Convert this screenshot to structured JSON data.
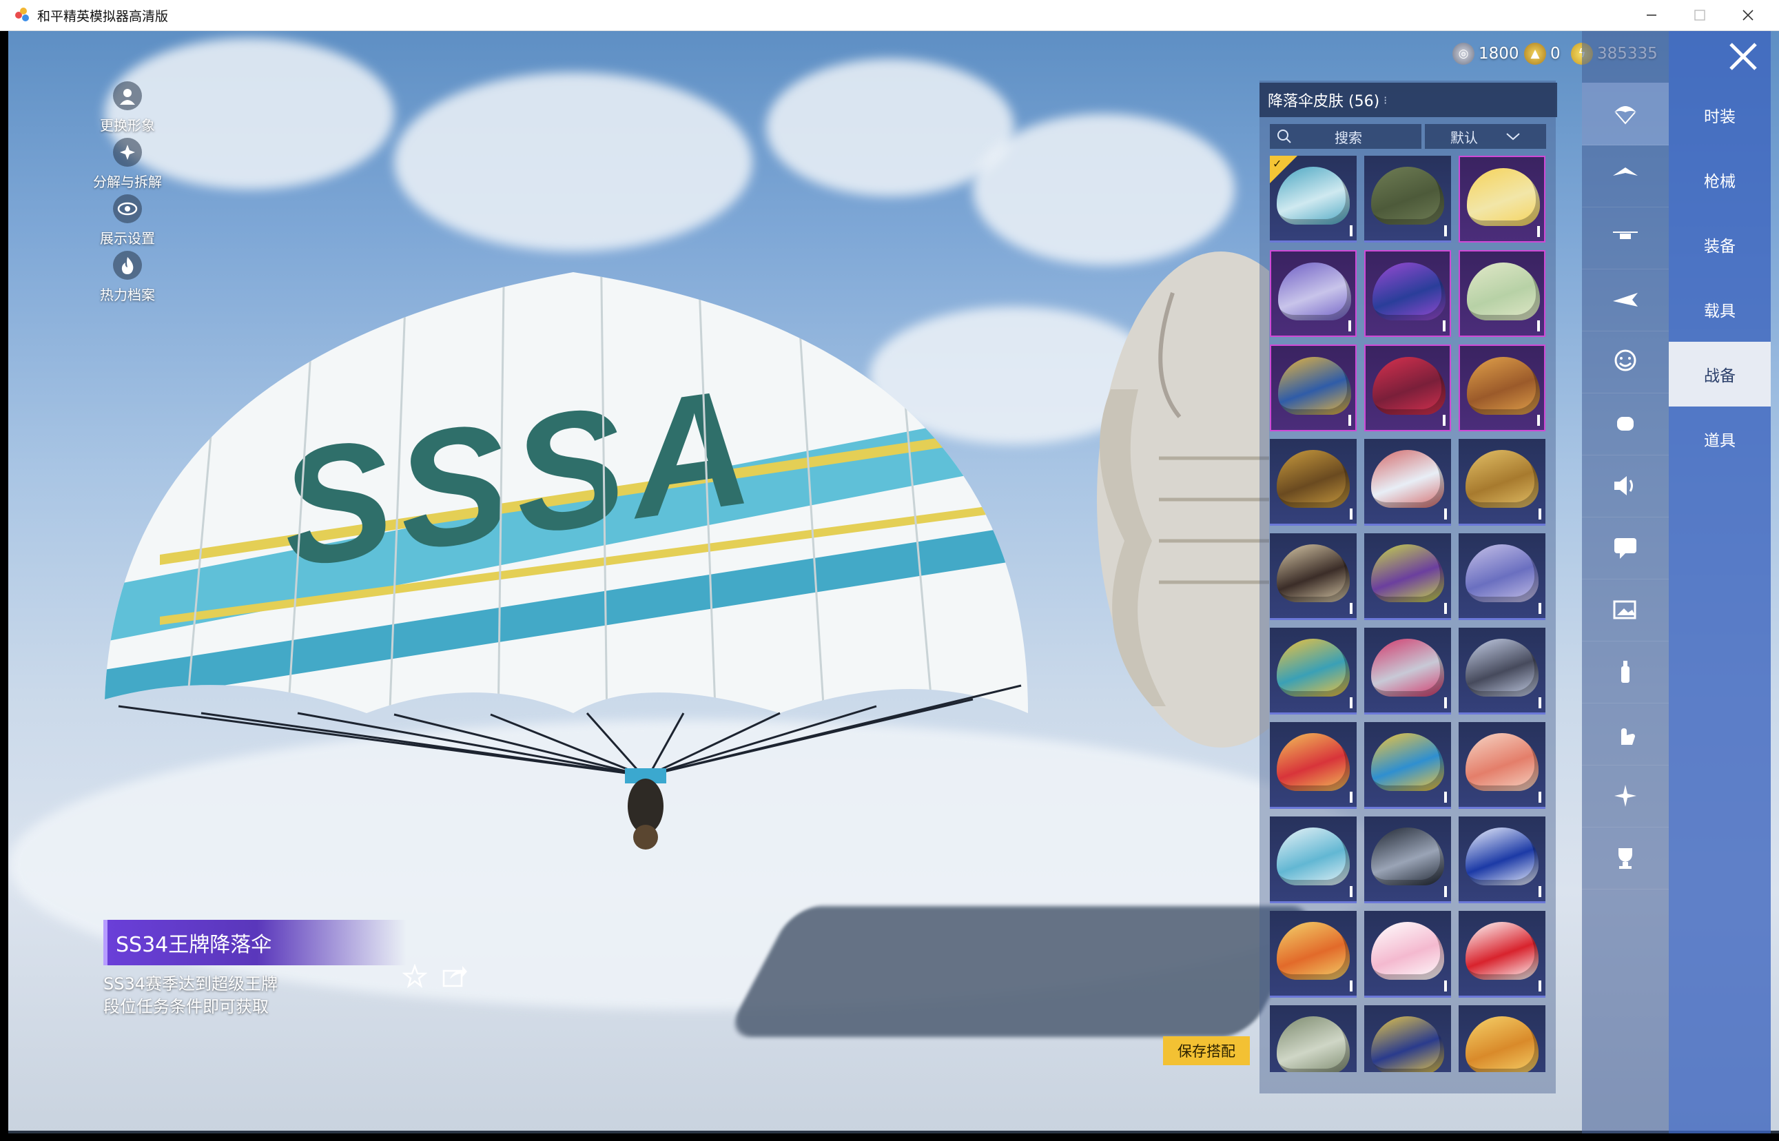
{
  "window": {
    "title": "和平精英模拟器高清版"
  },
  "left_tools": [
    {
      "label": "更换形象",
      "icon": "avatar-icon"
    },
    {
      "label": "分解与拆解",
      "icon": "dismantle-icon"
    },
    {
      "label": "展示设置",
      "icon": "eye-icon"
    },
    {
      "label": "热力档案",
      "icon": "flame-icon"
    }
  ],
  "currencies": [
    {
      "icon": "coin-silver-icon",
      "amount": "1800"
    },
    {
      "icon": "coin-gold-icon",
      "amount": "0"
    },
    {
      "icon": "coin-lightning-icon",
      "amount": "385335"
    }
  ],
  "panel": {
    "header": "降落伞皮肤 (56)",
    "search_placeholder": "搜索",
    "sort_label": "默认"
  },
  "item": {
    "name": "SS34王牌降落伞",
    "description_line1": "SS34赛季达到超级王牌",
    "description_line2": "段位任务条件即可获取",
    "save_label": "保存搭配"
  },
  "skins": [
    {
      "frame": "blue",
      "color": "#cfe9f0",
      "accent": "#4aa6c2",
      "selected": true
    },
    {
      "frame": "blue",
      "color": "#4d5a3a",
      "accent": "#6f7d55",
      "selected": false
    },
    {
      "frame": "purple",
      "color": "#f2e6a8",
      "accent": "#f6d35a",
      "selected": false
    },
    {
      "frame": "purple",
      "color": "#c8c4ea",
      "accent": "#6f5fc5",
      "selected": false
    },
    {
      "frame": "purple",
      "color": "#2a3e9a",
      "accent": "#9a4ad3",
      "selected": false
    },
    {
      "frame": "purple",
      "color": "#b7d1a6",
      "accent": "#e1e8c8",
      "selected": false
    },
    {
      "frame": "purple",
      "color": "#2f5ca8",
      "accent": "#e8b53d",
      "selected": false
    },
    {
      "frame": "purple",
      "color": "#7a1f3a",
      "accent": "#d8314f",
      "selected": false
    },
    {
      "frame": "purple",
      "color": "#9b5a2a",
      "accent": "#e2a24b",
      "selected": false
    },
    {
      "frame": "blue",
      "color": "#6a4a20",
      "accent": "#c99b3e",
      "selected": false
    },
    {
      "frame": "blue",
      "color": "#e8eef6",
      "accent": "#d46a6a",
      "selected": false
    },
    {
      "frame": "blue",
      "color": "#a77a2e",
      "accent": "#e3c067",
      "selected": false
    },
    {
      "frame": "blue",
      "color": "#3b2d28",
      "accent": "#d8c9a8",
      "selected": false
    },
    {
      "frame": "blue",
      "color": "#6b3f9e",
      "accent": "#c8d64a",
      "selected": false
    },
    {
      "frame": "blue",
      "color": "#6a6fc0",
      "accent": "#c6c1e8",
      "selected": false
    },
    {
      "frame": "blue",
      "color": "#3aa0b6",
      "accent": "#f0c23c",
      "selected": false
    },
    {
      "frame": "blue",
      "color": "#c8c9d6",
      "accent": "#d2386a",
      "selected": false
    },
    {
      "frame": "blue",
      "color": "#464a5c",
      "accent": "#c6d0e8",
      "selected": false
    },
    {
      "frame": "blue",
      "color": "#d8343a",
      "accent": "#f2c15a",
      "selected": false
    },
    {
      "frame": "blue",
      "color": "#2f8fd0",
      "accent": "#f3c63a",
      "selected": false
    },
    {
      "frame": "blue",
      "color": "#e47e6a",
      "accent": "#f6d6c6",
      "selected": false
    },
    {
      "frame": "blue",
      "color": "#62b7d3",
      "accent": "#e9f3f7",
      "selected": false
    },
    {
      "frame": "blue",
      "color": "#9aa4b6",
      "accent": "#1f2632",
      "selected": false
    },
    {
      "frame": "blue",
      "color": "#1c3aa6",
      "accent": "#eef2ff",
      "selected": false
    },
    {
      "frame": "blue",
      "color": "#e26a2a",
      "accent": "#f3d36c",
      "selected": false
    },
    {
      "frame": "blue",
      "color": "#f4b9cf",
      "accent": "#ffffff",
      "selected": false
    },
    {
      "frame": "blue",
      "color": "#d8232d",
      "accent": "#ffffff",
      "selected": false
    },
    {
      "frame": "blue",
      "color": "#cfd6c6",
      "accent": "#7c8a6e",
      "selected": false
    },
    {
      "frame": "blue",
      "color": "#2a3b8c",
      "accent": "#e6c74a",
      "selected": false
    },
    {
      "frame": "blue",
      "color": "#d98a2a",
      "accent": "#f6d26a",
      "selected": false
    }
  ],
  "icon_tabs": [
    {
      "icon": "parachute-icon",
      "active": true
    },
    {
      "icon": "glider-icon",
      "active": false
    },
    {
      "icon": "drone-icon",
      "active": false
    },
    {
      "icon": "plane-icon",
      "active": false
    },
    {
      "icon": "emote-icon",
      "active": false
    },
    {
      "icon": "companion-icon",
      "active": false
    },
    {
      "icon": "speaker-icon",
      "active": false
    },
    {
      "icon": "chat-icon",
      "active": false
    },
    {
      "icon": "gallery-icon",
      "active": false
    },
    {
      "icon": "spray-icon",
      "active": false
    },
    {
      "icon": "hand-gesture-icon",
      "active": false
    },
    {
      "icon": "sparkle-icon",
      "active": false
    },
    {
      "icon": "trophy-icon",
      "active": false
    }
  ],
  "text_tabs": [
    {
      "label": "时装",
      "active": false
    },
    {
      "label": "枪械",
      "active": false
    },
    {
      "label": "装备",
      "active": false
    },
    {
      "label": "载具",
      "active": false
    },
    {
      "label": "战备",
      "active": true
    },
    {
      "label": "道具",
      "active": false
    }
  ]
}
